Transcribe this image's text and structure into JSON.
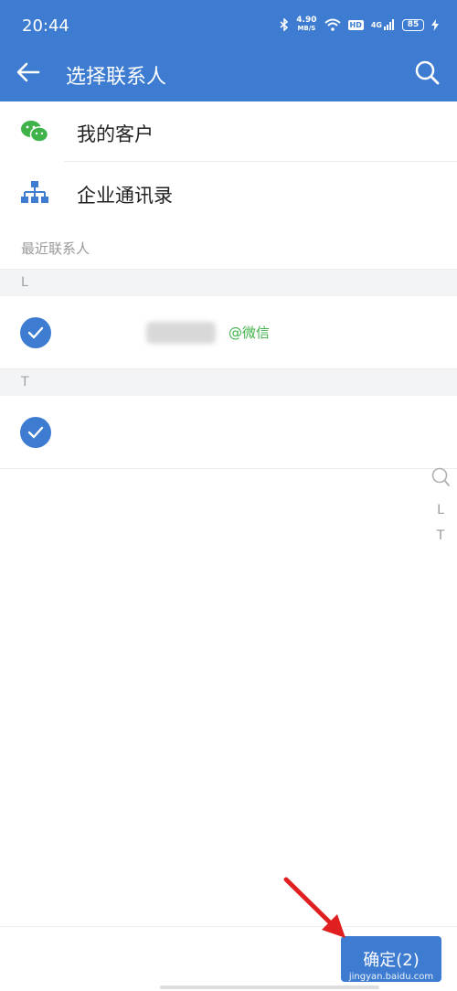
{
  "status_bar": {
    "time": "20:44",
    "net_speed_value": "4.90",
    "net_speed_unit": "MB/S",
    "hd_label": "HD",
    "signal_label": "4G",
    "battery": "85"
  },
  "header": {
    "title": "选择联系人"
  },
  "menu": {
    "items": [
      {
        "label": "我的客户",
        "icon": "wechat-icon"
      },
      {
        "label": "企业通讯录",
        "icon": "org-chart-icon"
      }
    ]
  },
  "recent": {
    "label": "最近联系人"
  },
  "sections": [
    {
      "letter": "L",
      "contacts": [
        {
          "source": "@微信",
          "checked": true
        }
      ]
    },
    {
      "letter": "T",
      "contacts": [
        {
          "source": "",
          "checked": true
        }
      ]
    }
  ],
  "alpha_index": [
    "L",
    "T"
  ],
  "bottom": {
    "confirm_label": "确定(2)",
    "watermark": "jingyan.baidu.com"
  },
  "colors": {
    "primary": "#3d7cd0",
    "wechat_green": "#3fb24a",
    "annotation_red": "#e02020"
  }
}
